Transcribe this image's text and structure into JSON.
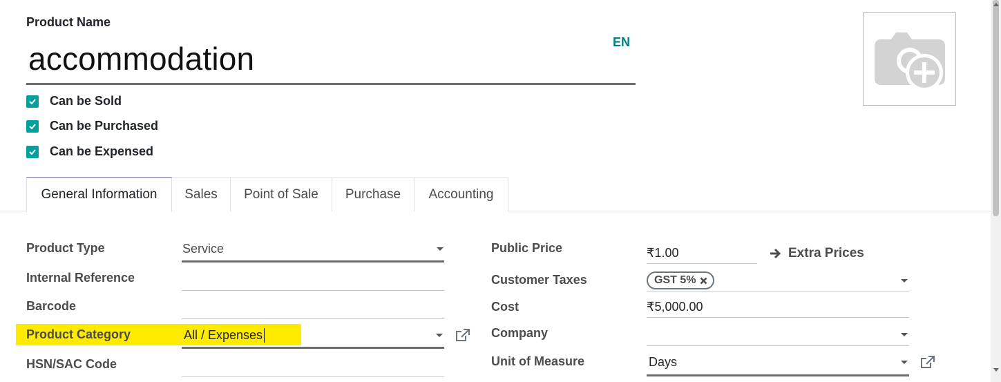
{
  "header": {
    "product_name_label": "Product Name",
    "product_name_value": "accommodation",
    "language_button": "EN"
  },
  "flags": [
    {
      "label": "Can be Sold",
      "checked": true
    },
    {
      "label": "Can be Purchased",
      "checked": true
    },
    {
      "label": "Can be Expensed",
      "checked": true
    }
  ],
  "tabs": [
    {
      "label": "General Information",
      "active": true
    },
    {
      "label": "Sales",
      "active": false
    },
    {
      "label": "Point of Sale",
      "active": false
    },
    {
      "label": "Purchase",
      "active": false
    },
    {
      "label": "Accounting",
      "active": false
    }
  ],
  "left_fields": {
    "product_type": {
      "label": "Product Type",
      "value": "Service"
    },
    "internal_reference": {
      "label": "Internal Reference",
      "value": ""
    },
    "barcode": {
      "label": "Barcode",
      "value": ""
    },
    "product_category": {
      "label": "Product Category",
      "value": "All / Expenses"
    },
    "hsn_sac_code": {
      "label": "HSN/SAC Code",
      "value": ""
    }
  },
  "right_fields": {
    "public_price": {
      "label": "Public Price",
      "value": "₹1.00"
    },
    "extra_prices_button": "Extra Prices",
    "customer_taxes": {
      "label": "Customer Taxes",
      "tag": "GST 5%"
    },
    "cost": {
      "label": "Cost",
      "value": "₹5,000.00"
    },
    "company": {
      "label": "Company",
      "value": ""
    },
    "unit_of_measure": {
      "label": "Unit of Measure",
      "value": "Days"
    }
  },
  "colors": {
    "accent_teal": "#00a09d",
    "language_teal": "#017e84",
    "highlight_yellow": "#ffeb00",
    "tab_active_border": "#71639e"
  },
  "icons": {
    "image_placeholder": "camera-plus-icon",
    "extra_prices": "arrow-right-icon",
    "tag_remove": "close-icon",
    "external_link": "external-link-icon",
    "dropdown": "caret-down-icon",
    "checkbox": "checkmark-icon"
  }
}
